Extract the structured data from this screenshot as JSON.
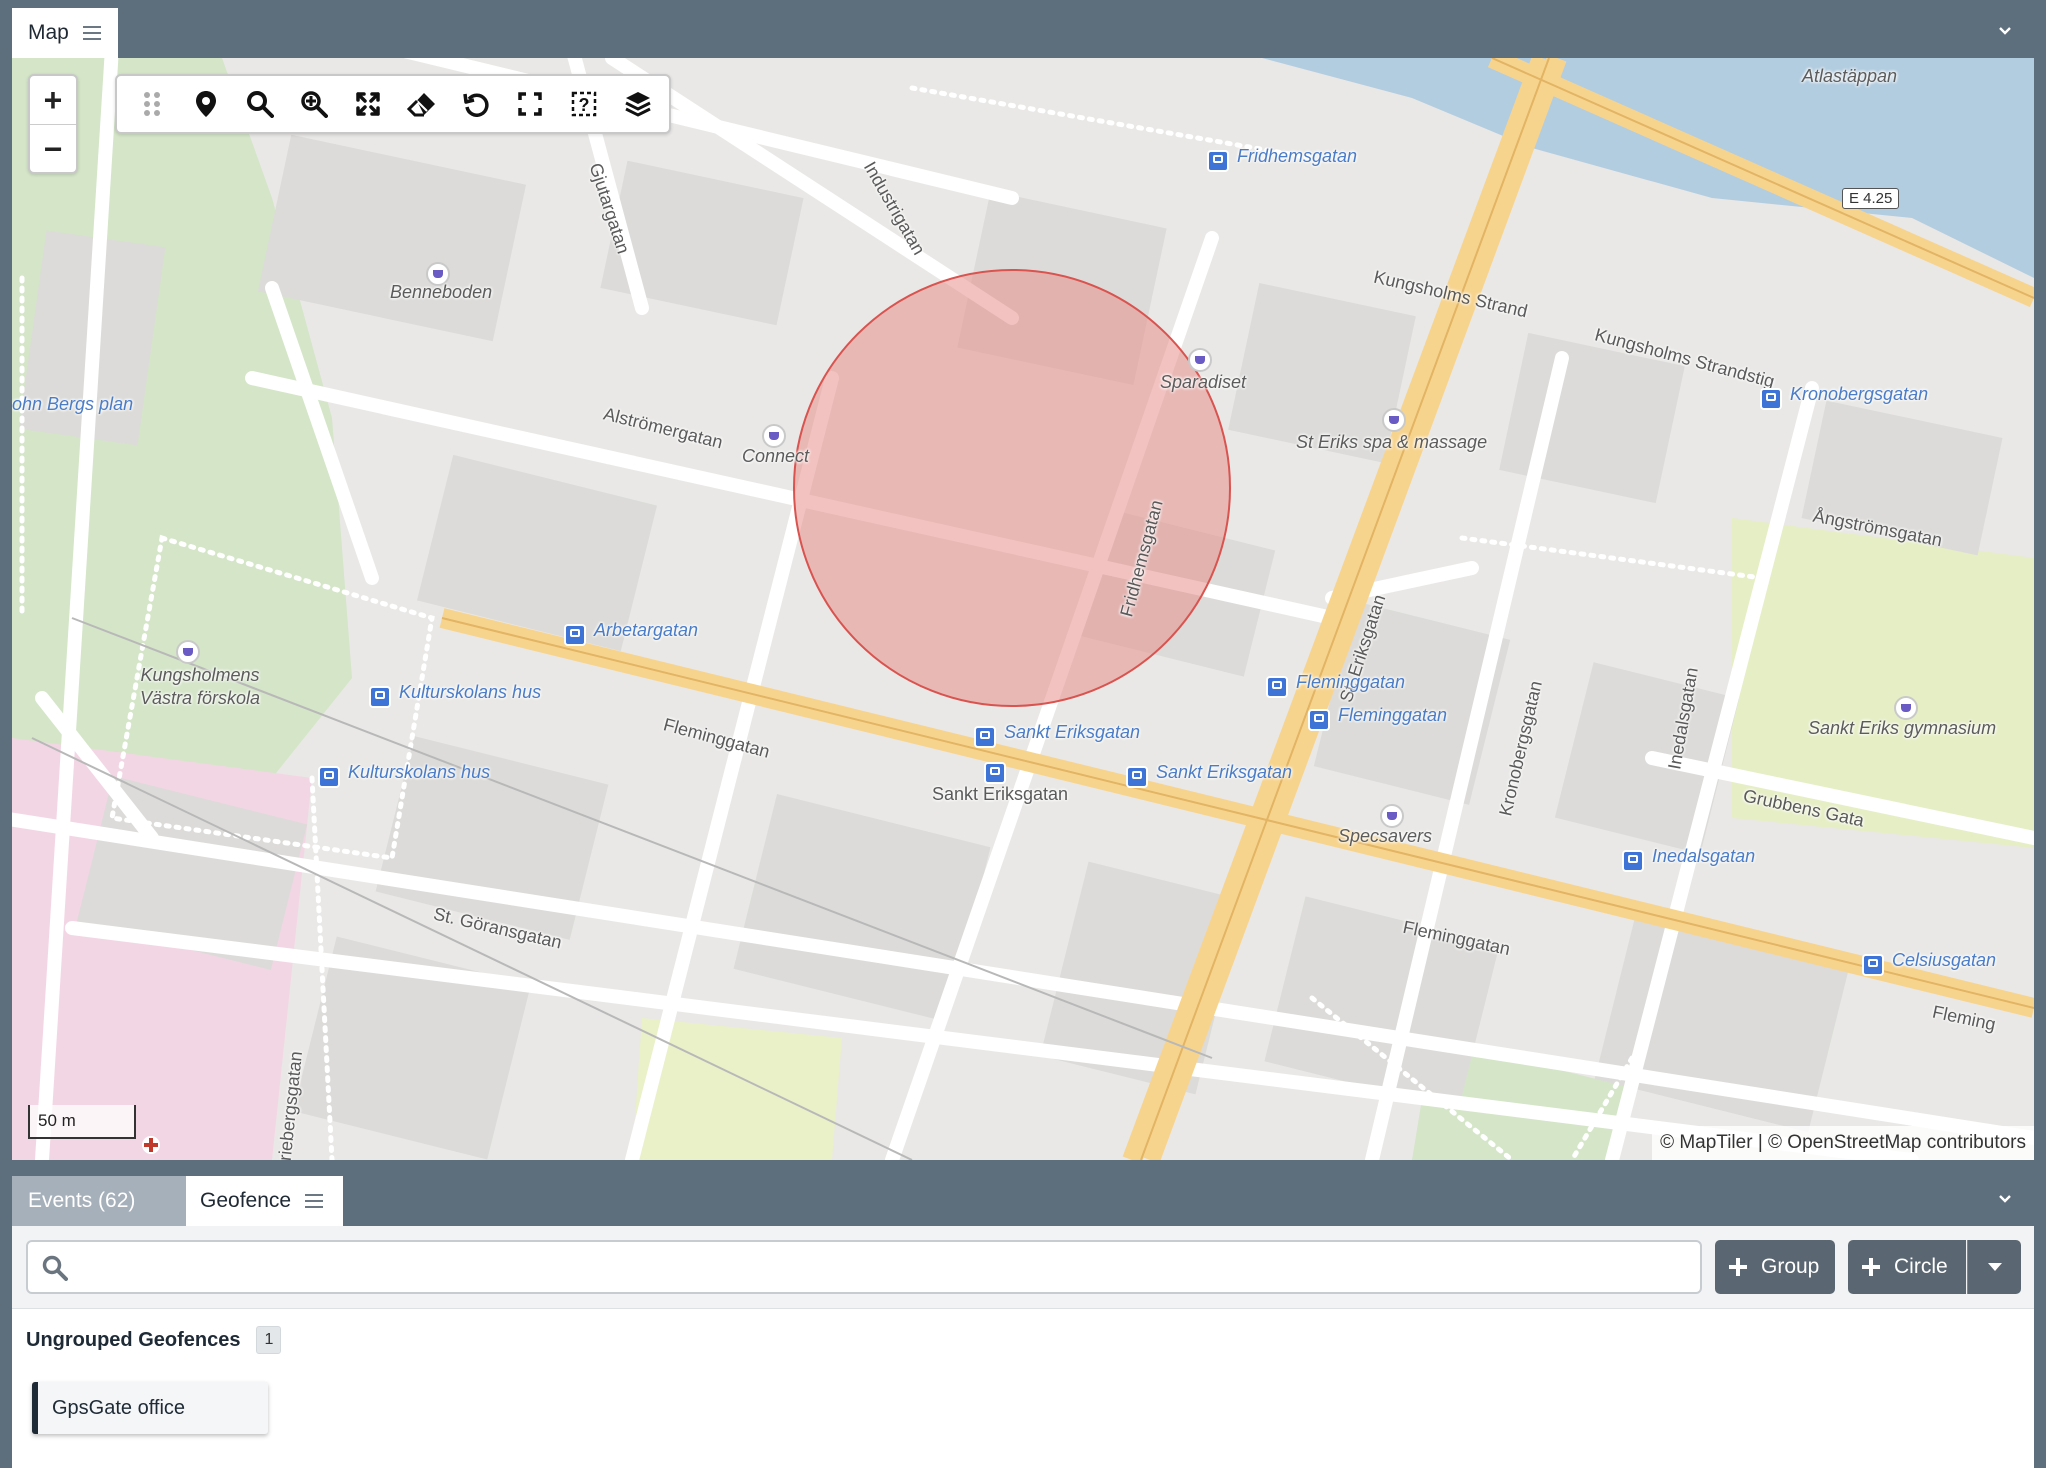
{
  "map_panel": {
    "tab_label": "Map"
  },
  "map": {
    "scale_label": "50 m",
    "attribution": "© MapTiler | © OpenStreetMap contributors",
    "road_badge": "E 4.25",
    "geofence_color": "#e8908c",
    "streets": [
      "Kungsholms Strand",
      "Kungsholms Strandstig",
      "Alströmergatan",
      "Fleminggatan",
      "Fleminggatan",
      "Fleminggatan",
      "Fridhemsgatan",
      "St. Eriksgatan",
      "Kronobergsgatan",
      "Inedalsgatan",
      "Ångströmsgatan",
      "Grubbens Gata",
      "St. Göransgatan",
      "Mariebergsgatan",
      "Gjutargatan",
      "Industrigatan",
      "Sankt Eriksgatan",
      "Fleming"
    ],
    "stops": [
      "Fridhemsgatan",
      "Kronobergsgatan",
      "Arbetargatan",
      "Kulturskolans hus",
      "Kulturskolans hus",
      "Fleminggatan",
      "Fleminggatan",
      "Sankt Eriksgatan",
      "Sankt Eriksgatan",
      "Inedalsgatan",
      "Celsiusgatan",
      "ohn Bergs plan"
    ],
    "pois": [
      "Atlastäppan",
      "Benneboden",
      "Sparadiset",
      "St Eriks spa & massage",
      "Connect",
      "Kungsholmens Västra förskola",
      "Sankt Eriks gymnasium",
      "Specsavers"
    ]
  },
  "toolbar": [
    "drag-handle",
    "marker",
    "search",
    "zoom-in",
    "fit-extent",
    "eraser",
    "undo",
    "fullscreen",
    "help-select",
    "layers"
  ],
  "bottom_panel": {
    "tabs": [
      {
        "label": "Events (62)"
      },
      {
        "label": "Geofence"
      }
    ],
    "search_placeholder": "",
    "buttons": {
      "group": "Group",
      "circle": "Circle"
    },
    "group": {
      "title": "Ungrouped Geofences",
      "count": "1"
    },
    "geofences": [
      {
        "name": "GpsGate office"
      }
    ]
  }
}
